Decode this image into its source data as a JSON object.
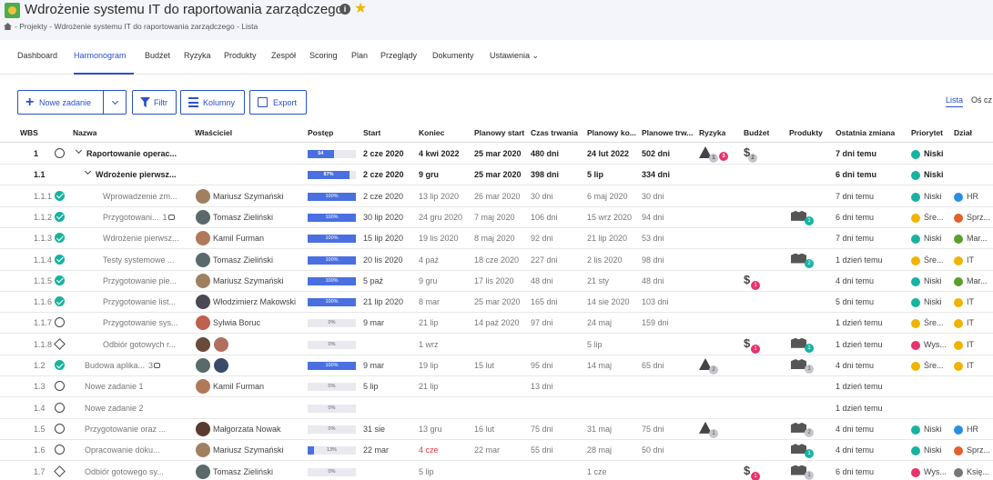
{
  "header": {
    "title": "Wdrożenie systemu IT do raportowania zarządczego",
    "breadcrumb": "- Projekty - Wdrożenie systemu IT do raportowania zarządczego - Lista"
  },
  "tabs": [
    "Dashboard",
    "Harmonogram",
    "Budżet",
    "Ryzyka",
    "Produkty",
    "Zespół",
    "Scoring",
    "Plan",
    "Przeglądy",
    "Dokumenty",
    "Ustawienia"
  ],
  "toolbar": {
    "new_task": "Nowe zadanie",
    "filter": "Filtr",
    "columns": "Kolumny",
    "export": "Export",
    "view_list": "Lista",
    "view_timeline": "Oś cz"
  },
  "columns": {
    "wbs": "WBS",
    "name": "Nazwa",
    "owner": "Właściciel",
    "progress": "Postęp",
    "start": "Start",
    "end": "Koniec",
    "planned_start": "Planowy start",
    "duration": "Czas trwania",
    "planned_end": "Planowy ko...",
    "planned_duration": "Planowe trw...",
    "risk": "Ryzyka",
    "budget": "Budżet",
    "products": "Produkty",
    "last_change": "Ostatnia zmiana",
    "priority": "Priorytet",
    "dept": "Dział"
  },
  "colors": {
    "accent": "#2b4fcc",
    "progress": "#4a6fe0",
    "status_done": "#17b3a0",
    "badge_red": "#e8336b",
    "priority_low": "#17b3a0",
    "priority_medium": "#f0b400",
    "priority_high": "#e8336b"
  },
  "rows": [
    {
      "wbs": "1",
      "name": "Raportowanie operac...",
      "status": "open",
      "summary": true,
      "caret": true,
      "level": 0,
      "owner": "",
      "progress_label": "54",
      "progress": 0.54,
      "start": "2 cze 2020",
      "end": "4 kwi 2022",
      "planned_start": "25 mar 2020",
      "duration": "480 dni",
      "planned_end": "24 lut 2022",
      "planned_duration": "502 dni",
      "risk": [
        "1",
        "3"
      ],
      "budget": [
        "2"
      ],
      "products": [],
      "last_change": "7 dni temu",
      "priority": "Niski",
      "priority_color": "#17b3a0",
      "dept": "",
      "dept_color": ""
    },
    {
      "wbs": "1.1",
      "name": "Wdrożenie pierwsz...",
      "status": "none",
      "summary": true,
      "caret": true,
      "level": 1,
      "owner": "",
      "progress_label": "87%",
      "progress": 0.87,
      "start": "2 cze 2020",
      "end": "9 gru",
      "planned_start": "25 mar 2020",
      "duration": "398 dni",
      "planned_end": "5 lip",
      "planned_duration": "334 dni",
      "risk": [],
      "budget": [],
      "products": [],
      "last_change": "6 dni temu",
      "priority": "Niski",
      "priority_color": "#17b3a0",
      "dept": "",
      "dept_color": ""
    },
    {
      "wbs": "1.1.1",
      "name": "Wprowadzenie zm...",
      "status": "done",
      "level": 2,
      "owner": "Mariusz Szymański",
      "avatar": "#a08060",
      "progress_label": "100%",
      "progress": 1,
      "start": "2 cze 2020",
      "end": "13 lip 2020",
      "planned_start": "26 mar 2020",
      "duration": "30 dni",
      "planned_end": "6 maj 2020",
      "planned_duration": "30 dni",
      "risk": [],
      "budget": [],
      "products": [],
      "last_change": "7 dni temu",
      "priority": "Niski",
      "priority_color": "#17b3a0",
      "dept": "HR",
      "dept_color": "#2b8ee0"
    },
    {
      "wbs": "1.1.2",
      "name": "Przygotowani...",
      "comments": "1",
      "status": "done",
      "level": 2,
      "owner": "Tomasz Zieliński",
      "avatar": "#5a6a6a",
      "progress_label": "100%",
      "progress": 1,
      "start": "30 lip 2020",
      "end": "24 gru 2020",
      "planned_start": "7 maj 2020",
      "duration": "106 dni",
      "planned_end": "15 wrz 2020",
      "planned_duration": "94 dni",
      "risk": [],
      "budget": [],
      "products": [
        "1"
      ],
      "product_badge": "teal",
      "last_change": "6 dni temu",
      "priority": "Śre...",
      "priority_color": "#f0b400",
      "dept": "Sprz...",
      "dept_color": "#e2602b"
    },
    {
      "wbs": "1.1.3",
      "name": "Wdrożenie pierwsz...",
      "status": "done",
      "level": 2,
      "owner": "Kamil Furman",
      "avatar": "#b07a5a",
      "progress_label": "100%",
      "progress": 1,
      "start": "15 lip 2020",
      "end": "19 lis 2020",
      "planned_start": "8 maj 2020",
      "duration": "92 dni",
      "planned_end": "21 lip 2020",
      "planned_duration": "53 dni",
      "risk": [],
      "budget": [],
      "products": [],
      "last_change": "7 dni temu",
      "priority": "Niski",
      "priority_color": "#17b3a0",
      "dept": "Mar...",
      "dept_color": "#5aa02b"
    },
    {
      "wbs": "1.1.4",
      "name": "Testy systemowe ...",
      "status": "done",
      "level": 2,
      "owner": "Tomasz Zieliński",
      "avatar": "#5a6a6a",
      "progress_label": "100%",
      "progress": 1,
      "start": "20 lis 2020",
      "end": "4 paź",
      "planned_start": "18 cze 2020",
      "duration": "227 dni",
      "planned_end": "2 lis 2020",
      "planned_duration": "98 dni",
      "risk": [],
      "budget": [],
      "products": [
        "2"
      ],
      "product_badge": "teal",
      "last_change": "1 dzień temu",
      "priority": "Śre...",
      "priority_color": "#f0b400",
      "dept": "IT",
      "dept_color": "#f0b400"
    },
    {
      "wbs": "1.1.5",
      "name": "Przygotowanie pie...",
      "status": "done",
      "level": 2,
      "owner": "Mariusz Szymański",
      "avatar": "#a08060",
      "progress_label": "100%",
      "progress": 1,
      "start": "5 paź",
      "end": "9 gru",
      "planned_start": "17 lis 2020",
      "duration": "48 dni",
      "planned_end": "21 sty",
      "planned_duration": "48 dni",
      "risk": [],
      "budget": [
        "1"
      ],
      "budget_badge": "red",
      "products": [],
      "last_change": "4 dni temu",
      "priority": "Niski",
      "priority_color": "#17b3a0",
      "dept": "Mar...",
      "dept_color": "#5aa02b"
    },
    {
      "wbs": "1.1.6",
      "name": "Przygotowanie list...",
      "status": "done",
      "level": 2,
      "owner": "Włodzimierz Makowski",
      "avatar": "#4a4a55",
      "progress_label": "100%",
      "progress": 1,
      "start": "21 lip 2020",
      "end": "8 mar",
      "planned_start": "25 mar 2020",
      "duration": "165 dni",
      "planned_end": "14 sie 2020",
      "planned_duration": "103 dni",
      "risk": [],
      "budget": [],
      "products": [],
      "last_change": "5 dni temu",
      "priority": "Niski",
      "priority_color": "#17b3a0",
      "dept": "IT",
      "dept_color": "#f0b400"
    },
    {
      "wbs": "1.1.7",
      "name": "Przygotowanie sys...",
      "status": "open",
      "level": 2,
      "owner": "Sylwia Boruc",
      "avatar": "#c06050",
      "progress_label": "0%",
      "progress": 0,
      "start": "9 mar",
      "end": "21 lip",
      "planned_start": "14 paź 2020",
      "duration": "97 dni",
      "planned_end": "24 maj",
      "planned_duration": "159 dni",
      "risk": [],
      "budget": [],
      "products": [],
      "last_change": "1 dzień temu",
      "priority": "Śre...",
      "priority_color": "#f0b400",
      "dept": "IT",
      "dept_color": "#f0b400"
    },
    {
      "wbs": "1.1.8",
      "name": "Odbiór gotowych r...",
      "status": "milestone",
      "level": 2,
      "owner": "",
      "avatars": [
        "#6a4a3a",
        "#b07060"
      ],
      "progress_label": "0%",
      "progress": 0,
      "start": "",
      "end": "1 wrz",
      "planned_start": "",
      "duration": "",
      "planned_end": "5 lip",
      "planned_duration": "",
      "risk": [],
      "budget": [
        "1"
      ],
      "budget_badge": "red",
      "products": [
        "1"
      ],
      "product_badge": "teal",
      "last_change": "1 dzień temu",
      "priority": "Wys...",
      "priority_color": "#e8336b",
      "dept": "IT",
      "dept_color": "#f0b400"
    },
    {
      "wbs": "1.2",
      "name": "Budowa aplika...",
      "comments": "3",
      "status": "done",
      "level": 1,
      "owner": "",
      "avatars": [
        "#5a6a6a",
        "#3a4a6a"
      ],
      "progress_label": "100%",
      "progress": 1,
      "start": "9 mar",
      "end": "19 lip",
      "planned_start": "15 lut",
      "duration": "95 dni",
      "planned_end": "14 maj",
      "planned_duration": "65 dni",
      "risk": [
        "2"
      ],
      "budget": [],
      "products": [
        "1"
      ],
      "product_badge": "grey",
      "last_change": "4 dni temu",
      "priority": "Śre...",
      "priority_color": "#f0b400",
      "dept": "IT",
      "dept_color": "#f0b400"
    },
    {
      "wbs": "1.3",
      "name": "Nowe zadanie 1",
      "status": "open",
      "level": 1,
      "owner": "Kamil Furman",
      "avatar": "#b07a5a",
      "progress_label": "0%",
      "progress": 0,
      "start": "5 lip",
      "end": "21 lip",
      "planned_start": "",
      "duration": "13 dni",
      "planned_end": "",
      "planned_duration": "",
      "risk": [],
      "budget": [],
      "products": [],
      "last_change": "1 dzień temu",
      "priority": "",
      "priority_color": "",
      "dept": "",
      "dept_color": ""
    },
    {
      "wbs": "1.4",
      "name": "Nowe zadanie 2",
      "status": "open",
      "level": 1,
      "owner": "",
      "progress_label": "0%",
      "progress": 0,
      "start": "",
      "end": "",
      "planned_start": "",
      "duration": "",
      "planned_end": "",
      "planned_duration": "",
      "risk": [],
      "budget": [],
      "products": [],
      "last_change": "1 dzień temu",
      "priority": "",
      "priority_color": "",
      "dept": "",
      "dept_color": ""
    },
    {
      "wbs": "1.5",
      "name": "Przygotowanie oraz ...",
      "status": "open",
      "level": 1,
      "owner": "Małgorzata Nowak",
      "avatar": "#5a3a30",
      "progress_label": "0%",
      "progress": 0,
      "start": "31 sie",
      "end": "13 gru",
      "planned_start": "16 lut",
      "duration": "75 dni",
      "planned_end": "31 maj",
      "planned_duration": "75 dni",
      "risk": [
        "1"
      ],
      "budget": [],
      "products": [
        "2"
      ],
      "product_badge": "grey",
      "last_change": "4 dni temu",
      "priority": "Niski",
      "priority_color": "#17b3a0",
      "dept": "HR",
      "dept_color": "#2b8ee0"
    },
    {
      "wbs": "1.6",
      "name": "Opracowanie doku...",
      "status": "open",
      "level": 1,
      "owner": "Mariusz Szymański",
      "avatar": "#a08060",
      "progress_label": "13%",
      "progress": 0.13,
      "start": "22 mar",
      "end": "4 cze",
      "end_late": true,
      "planned_start": "22 mar",
      "duration": "55 dni",
      "planned_end": "28 maj",
      "planned_duration": "50 dni",
      "risk": [],
      "budget": [],
      "products": [
        "1"
      ],
      "product_badge": "teal",
      "last_change": "4 dni temu",
      "priority": "Niski",
      "priority_color": "#17b3a0",
      "dept": "Sprz...",
      "dept_color": "#e2602b"
    },
    {
      "wbs": "1.7",
      "name": "Odbiór gotowego sy...",
      "status": "milestone",
      "level": 1,
      "owner": "Tomasz Zieliński",
      "avatar": "#5a6a6a",
      "progress_label": "0%",
      "progress": 0,
      "start": "",
      "end": "5 lip",
      "planned_start": "",
      "duration": "",
      "planned_end": "1 cze",
      "planned_duration": "",
      "risk": [],
      "budget": [
        "1"
      ],
      "budget_badge": "red",
      "products": [
        "1"
      ],
      "product_badge": "grey",
      "last_change": "6 dni temu",
      "priority": "Wys...",
      "priority_color": "#e8336b",
      "dept": "Księ...",
      "dept_color": "#777777"
    }
  ]
}
